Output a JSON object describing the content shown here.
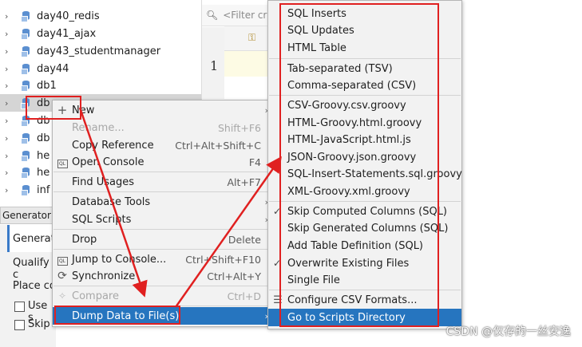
{
  "tree": {
    "items": [
      {
        "label": "day40_redis"
      },
      {
        "label": "day41_ajax"
      },
      {
        "label": "day43_studentmanager"
      },
      {
        "label": "day44"
      },
      {
        "label": "db1"
      },
      {
        "label": "db"
      },
      {
        "label": "db"
      },
      {
        "label": "db"
      },
      {
        "label": "he"
      },
      {
        "label": "he"
      },
      {
        "label": "inf"
      }
    ]
  },
  "editor": {
    "filter_placeholder": "<Filter cr",
    "line_number": "1"
  },
  "generator": {
    "tab_label": "Generator",
    "heading": "Generat",
    "qualify": "Qualify c",
    "place": "Place co",
    "use": "Use s",
    "skip": "Skip"
  },
  "context_menu": {
    "items": [
      {
        "label": "New",
        "shortcut": "",
        "icon": "plus-icon"
      },
      {
        "label": "Rename...",
        "shortcut": "Shift+F6"
      },
      {
        "label": "Copy Reference",
        "shortcut": "Ctrl+Alt+Shift+C"
      },
      {
        "label": "Open Console",
        "shortcut": "F4",
        "icon": "console-icon"
      },
      {
        "label": "Find Usages",
        "shortcut": "Alt+F7"
      },
      {
        "label": "Database Tools",
        "shortcut": ""
      },
      {
        "label": "SQL Scripts",
        "shortcut": ""
      },
      {
        "label": "Drop",
        "shortcut": "Delete"
      },
      {
        "label": "Jump to Console...",
        "shortcut": "Ctrl+Shift+F10",
        "icon": "console-icon"
      },
      {
        "label": "Synchronize",
        "shortcut": "Ctrl+Alt+Y",
        "icon": "sync-icon"
      },
      {
        "label": "Compare",
        "shortcut": "Ctrl+D",
        "icon": "compare-icon"
      },
      {
        "label": "Dump Data to File(s)",
        "shortcut": ""
      }
    ]
  },
  "submenu": {
    "items": [
      {
        "label": "SQL Inserts"
      },
      {
        "label": "SQL Updates"
      },
      {
        "label": "HTML Table"
      },
      {
        "label": "Tab-separated (TSV)"
      },
      {
        "label": "Comma-separated (CSV)"
      },
      {
        "label": "CSV-Groovy.csv.groovy"
      },
      {
        "label": "HTML-Groovy.html.groovy"
      },
      {
        "label": "HTML-JavaScript.html.js"
      },
      {
        "label": "JSON-Groovy.json.groovy"
      },
      {
        "label": "SQL-Insert-Statements.sql.groovy"
      },
      {
        "label": "XML-Groovy.xml.groovy"
      },
      {
        "label": "Skip Computed Columns (SQL)",
        "checked": true
      },
      {
        "label": "Skip Generated Columns (SQL)",
        "checked": false
      },
      {
        "label": "Add Table Definition (SQL)",
        "checked": false
      },
      {
        "label": "Overwrite Existing Files",
        "checked": true
      },
      {
        "label": "Single File",
        "checked": false
      },
      {
        "label": "Configure CSV Formats..."
      },
      {
        "label": "Go to Scripts Directory"
      }
    ]
  },
  "watermark": "CSDN @仅存的一丝安逸",
  "colors": {
    "highlight": "#2675bf",
    "annotation_red": "#e02020",
    "menu_bg": "#f2f2f2"
  }
}
